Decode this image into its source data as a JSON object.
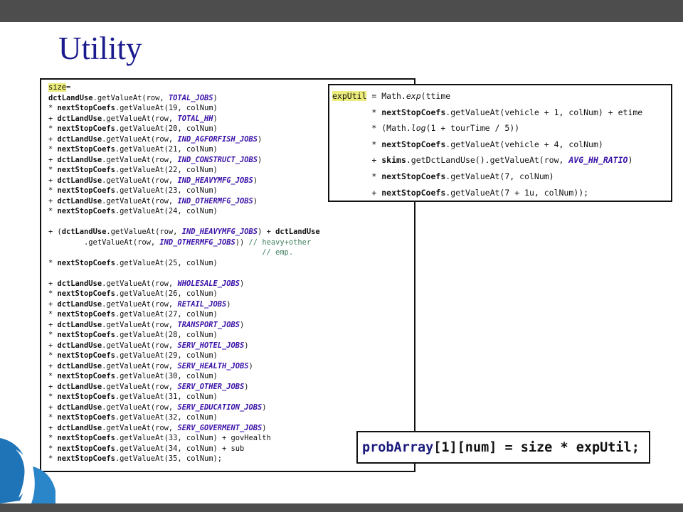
{
  "slide": {
    "title": "Utility"
  },
  "colors": {
    "title": "#1b1b8f",
    "constant": "#3a12a8",
    "comment": "#3f7f5f",
    "highlight": "#ecec7c",
    "bars": "#4d4d4d"
  },
  "main_code": {
    "lines": [
      [
        {
          "t": "size",
          "s": "hl"
        },
        {
          "t": "="
        }
      ],
      [
        {
          "t": "dctLandUse",
          "s": "b"
        },
        {
          "t": ".getValueAt(row, "
        },
        {
          "t": "TOTAL_JOBS",
          "s": "c"
        },
        {
          "t": ")"
        }
      ],
      [
        {
          "t": "* "
        },
        {
          "t": "nextStopCoefs",
          "s": "b"
        },
        {
          "t": ".getValueAt(19, colNum)"
        }
      ],
      [
        {
          "t": "+ "
        },
        {
          "t": "dctLandUse",
          "s": "b"
        },
        {
          "t": ".getValueAt(row, "
        },
        {
          "t": "TOTAL_HH",
          "s": "c"
        },
        {
          "t": ")"
        }
      ],
      [
        {
          "t": "* "
        },
        {
          "t": "nextStopCoefs",
          "s": "b"
        },
        {
          "t": ".getValueAt(20, colNum)"
        }
      ],
      [
        {
          "t": "+ "
        },
        {
          "t": "dctLandUse",
          "s": "b"
        },
        {
          "t": ".getValueAt(row, "
        },
        {
          "t": "IND_AGFORFISH_JOBS",
          "s": "c"
        },
        {
          "t": ")"
        }
      ],
      [
        {
          "t": "* "
        },
        {
          "t": "nextStopCoefs",
          "s": "b"
        },
        {
          "t": ".getValueAt(21, colNum)"
        }
      ],
      [
        {
          "t": "+ "
        },
        {
          "t": "dctLandUse",
          "s": "b"
        },
        {
          "t": ".getValueAt(row, "
        },
        {
          "t": "IND_CONSTRUCT_JOBS",
          "s": "c"
        },
        {
          "t": ")"
        }
      ],
      [
        {
          "t": "* "
        },
        {
          "t": "nextStopCoefs",
          "s": "b"
        },
        {
          "t": ".getValueAt(22, colNum)"
        }
      ],
      [
        {
          "t": "+ "
        },
        {
          "t": "dctLandUse",
          "s": "b"
        },
        {
          "t": ".getValueAt(row, "
        },
        {
          "t": "IND_HEAVYMFG_JOBS",
          "s": "c"
        },
        {
          "t": ")"
        }
      ],
      [
        {
          "t": "* "
        },
        {
          "t": "nextStopCoefs",
          "s": "b"
        },
        {
          "t": ".getValueAt(23, colNum)"
        }
      ],
      [
        {
          "t": "+ "
        },
        {
          "t": "dctLandUse",
          "s": "b"
        },
        {
          "t": ".getValueAt(row, "
        },
        {
          "t": "IND_OTHERMFG_JOBS",
          "s": "c"
        },
        {
          "t": ")"
        }
      ],
      [
        {
          "t": "* "
        },
        {
          "t": "nextStopCoefs",
          "s": "b"
        },
        {
          "t": ".getValueAt(24, colNum)"
        }
      ],
      [],
      [
        {
          "t": "+ ("
        },
        {
          "t": "dctLandUse",
          "s": "b"
        },
        {
          "t": ".getValueAt(row, "
        },
        {
          "t": "IND_HEAVYMFG_JOBS",
          "s": "c"
        },
        {
          "t": ") + "
        },
        {
          "t": "dctLandUse",
          "s": "b"
        }
      ],
      [
        {
          "t": "        .getValueAt(row, "
        },
        {
          "t": "IND_OTHERMFG_JOBS",
          "s": "c"
        },
        {
          "t": ")) "
        },
        {
          "t": "// heavy+other",
          "s": "m"
        }
      ],
      [
        {
          "t": "                                                "
        },
        {
          "t": "// emp.",
          "s": "m"
        }
      ],
      [
        {
          "t": "* "
        },
        {
          "t": "nextStopCoefs",
          "s": "b"
        },
        {
          "t": ".getValueAt(25, colNum)"
        }
      ],
      [],
      [
        {
          "t": "+ "
        },
        {
          "t": "dctLandUse",
          "s": "b"
        },
        {
          "t": ".getValueAt(row, "
        },
        {
          "t": "WHOLESALE_JOBS",
          "s": "c"
        },
        {
          "t": ")"
        }
      ],
      [
        {
          "t": "* "
        },
        {
          "t": "nextStopCoefs",
          "s": "b"
        },
        {
          "t": ".getValueAt(26, colNum)"
        }
      ],
      [
        {
          "t": "+ "
        },
        {
          "t": "dctLandUse",
          "s": "b"
        },
        {
          "t": ".getValueAt(row, "
        },
        {
          "t": "RETAIL_JOBS",
          "s": "c"
        },
        {
          "t": ")"
        }
      ],
      [
        {
          "t": "* "
        },
        {
          "t": "nextStopCoefs",
          "s": "b"
        },
        {
          "t": ".getValueAt(27, colNum)"
        }
      ],
      [
        {
          "t": "+ "
        },
        {
          "t": "dctLandUse",
          "s": "b"
        },
        {
          "t": ".getValueAt(row, "
        },
        {
          "t": "TRANSPORT_JOBS",
          "s": "c"
        },
        {
          "t": ")"
        }
      ],
      [
        {
          "t": "* "
        },
        {
          "t": "nextStopCoefs",
          "s": "b"
        },
        {
          "t": ".getValueAt(28, colNum)"
        }
      ],
      [
        {
          "t": "+ "
        },
        {
          "t": "dctLandUse",
          "s": "b"
        },
        {
          "t": ".getValueAt(row, "
        },
        {
          "t": "SERV_HOTEL_JOBS",
          "s": "c"
        },
        {
          "t": ")"
        }
      ],
      [
        {
          "t": "* "
        },
        {
          "t": "nextStopCoefs",
          "s": "b"
        },
        {
          "t": ".getValueAt(29, colNum)"
        }
      ],
      [
        {
          "t": "+ "
        },
        {
          "t": "dctLandUse",
          "s": "b"
        },
        {
          "t": ".getValueAt(row, "
        },
        {
          "t": "SERV_HEALTH_JOBS",
          "s": "c"
        },
        {
          "t": ")"
        }
      ],
      [
        {
          "t": "* "
        },
        {
          "t": "nextStopCoefs",
          "s": "b"
        },
        {
          "t": ".getValueAt(30, colNum)"
        }
      ],
      [
        {
          "t": "+ "
        },
        {
          "t": "dctLandUse",
          "s": "b"
        },
        {
          "t": ".getValueAt(row, "
        },
        {
          "t": "SERV_OTHER_JOBS",
          "s": "c"
        },
        {
          "t": ")"
        }
      ],
      [
        {
          "t": "* "
        },
        {
          "t": "nextStopCoefs",
          "s": "b"
        },
        {
          "t": ".getValueAt(31, colNum)"
        }
      ],
      [
        {
          "t": "+ "
        },
        {
          "t": "dctLandUse",
          "s": "b"
        },
        {
          "t": ".getValueAt(row, "
        },
        {
          "t": "SERV_EDUCATION_JOBS",
          "s": "c"
        },
        {
          "t": ")"
        }
      ],
      [
        {
          "t": "* "
        },
        {
          "t": "nextStopCoefs",
          "s": "b"
        },
        {
          "t": ".getValueAt(32, colNum)"
        }
      ],
      [
        {
          "t": "+ "
        },
        {
          "t": "dctLandUse",
          "s": "b"
        },
        {
          "t": ".getValueAt(row, "
        },
        {
          "t": "SERV_GOVERMENT_JOBS",
          "s": "c"
        },
        {
          "t": ")"
        }
      ],
      [
        {
          "t": "* "
        },
        {
          "t": "nextStopCoefs",
          "s": "b"
        },
        {
          "t": ".getValueAt(33, colNum) + govHealth"
        }
      ],
      [
        {
          "t": "* "
        },
        {
          "t": "nextStopCoefs",
          "s": "b"
        },
        {
          "t": ".getValueAt(34, colNum) + sub"
        }
      ],
      [
        {
          "t": "* "
        },
        {
          "t": "nextStopCoefs",
          "s": "b"
        },
        {
          "t": ".getValueAt(35, colNum);"
        }
      ]
    ]
  },
  "exp_code": {
    "lines": [
      [
        {
          "t": "expUtil",
          "s": "hl"
        },
        {
          "t": " = Math."
        },
        {
          "t": "exp",
          "s": "i"
        },
        {
          "t": "(ttime"
        }
      ],
      [
        {
          "t": "        * "
        },
        {
          "t": "nextStopCoefs",
          "s": "b"
        },
        {
          "t": ".getValueAt(vehicle + 1, colNum) + etime"
        }
      ],
      [
        {
          "t": "        * (Math."
        },
        {
          "t": "log",
          "s": "i"
        },
        {
          "t": "(1 + tourTime / 5))"
        }
      ],
      [
        {
          "t": "        * "
        },
        {
          "t": "nextStopCoefs",
          "s": "b"
        },
        {
          "t": ".getValueAt(vehicle + 4, colNum)"
        }
      ],
      [
        {
          "t": "        + "
        },
        {
          "t": "skims",
          "s": "b"
        },
        {
          "t": ".getDctLandUse().getValueAt(row, "
        },
        {
          "t": "AVG_HH_RATIO",
          "s": "c"
        },
        {
          "t": ")"
        }
      ],
      [
        {
          "t": "        * "
        },
        {
          "t": "nextStopCoefs",
          "s": "b"
        },
        {
          "t": ".getValueAt(7, colNum)"
        }
      ],
      [
        {
          "t": "        + "
        },
        {
          "t": "nextStopCoefs",
          "s": "b"
        },
        {
          "t": ".getValueAt(7 + 1u, colNum));"
        }
      ]
    ]
  },
  "prob_code": {
    "array": "probArray",
    "rest": "[1][num] = size * expUtil;"
  }
}
